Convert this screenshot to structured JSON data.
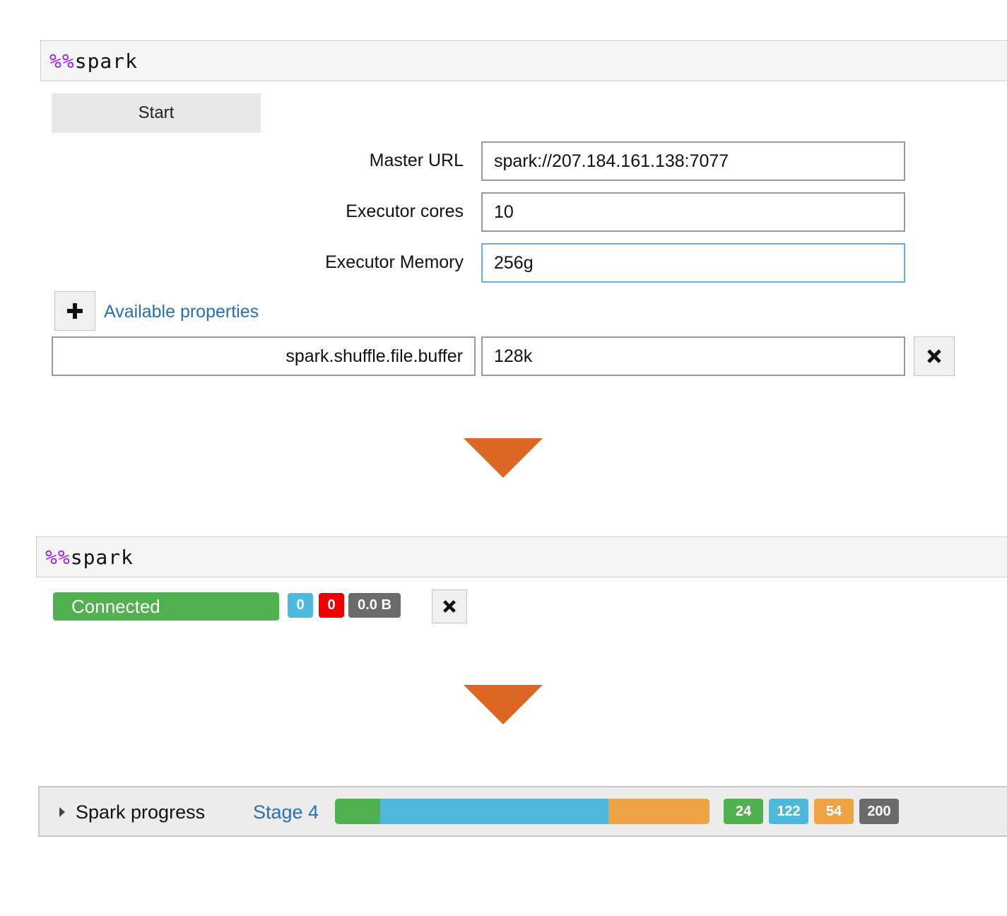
{
  "cell1": {
    "magic": "%%",
    "command": "spark",
    "start_label": "Start",
    "fields": [
      {
        "label": "Master URL",
        "value": "spark://207.184.161.138:7077"
      },
      {
        "label": "Executor cores",
        "value": "10"
      },
      {
        "label": "Executor Memory",
        "value": "256g"
      }
    ],
    "add_icon": "plus-icon",
    "available_properties": "Available properties",
    "property": {
      "key": "spark.shuffle.file.buffer",
      "value": "128k"
    },
    "remove_icon": "close-icon"
  },
  "cell2": {
    "magic": "%%",
    "command": "spark",
    "status": "Connected",
    "badges": [
      {
        "text": "0",
        "color": "#4fb9dc"
      },
      {
        "text": "0",
        "color": "#ee0000"
      },
      {
        "text": "0.0 B",
        "color": "#6b6b6b"
      }
    ],
    "close_icon": "close-icon"
  },
  "arrow_color": "#dc6624",
  "progress": {
    "title": "Spark progress",
    "stage": "Stage 4",
    "tasks": {
      "succeeded": 24,
      "running": 122,
      "pending": 54,
      "total": 200
    },
    "badges": [
      {
        "text": "24",
        "color": "#51b050"
      },
      {
        "text": "122",
        "color": "#4fb9dc"
      },
      {
        "text": "54",
        "color": "#eea445"
      },
      {
        "text": "200",
        "color": "#6b6b6b"
      }
    ],
    "segment_colors": {
      "succeeded": "#51b050",
      "running": "#4fb9dc",
      "pending": "#eea445"
    }
  }
}
